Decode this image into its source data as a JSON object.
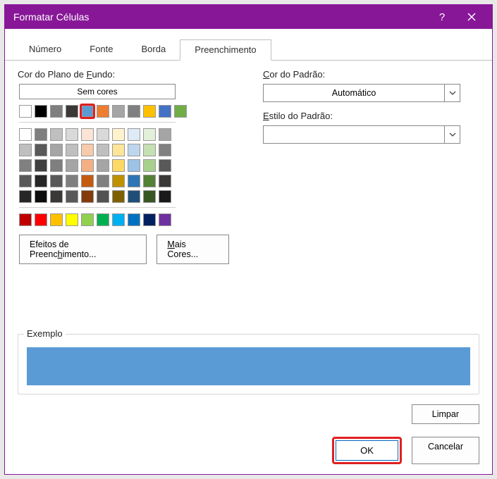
{
  "title": "Formatar Células",
  "tabs": {
    "numero": "Número",
    "fonte": "Fonte",
    "borda": "Borda",
    "preenchimento": "Preenchimento"
  },
  "left": {
    "bgLabelPre": "Cor do Plano de ",
    "bgLabelU": "F",
    "bgLabelPost": "undo:",
    "noColor": "Sem cores",
    "stdColors": [
      "#ffffff",
      "#000000",
      "#7f7f7f",
      "#3b3838",
      "#5b9bd5",
      "#ed7d31",
      "#a5a5a5",
      "#808080",
      "#ffc000",
      "#4472c4",
      "#70ad47"
    ],
    "themeGrid": [
      [
        "#ffffff",
        "#7f7f7f",
        "#bfbfbf",
        "#d9d9d9",
        "#fbe4d5",
        "#d9d9d9",
        "#fff2cc",
        "#deeaf6",
        "#e2efd9",
        "#a5a5a5"
      ],
      [
        "#bfbfbf",
        "#595959",
        "#a5a5a5",
        "#bfbfbf",
        "#f7caac",
        "#bfbfbf",
        "#ffe599",
        "#bdd6ee",
        "#c5e0b3",
        "#808080"
      ],
      [
        "#808080",
        "#404040",
        "#7f7f7f",
        "#a5a5a5",
        "#f4b083",
        "#a5a5a5",
        "#ffd966",
        "#9cc2e5",
        "#a8d08d",
        "#595959"
      ],
      [
        "#595959",
        "#262626",
        "#595959",
        "#7f7f7f",
        "#c55a11",
        "#808080",
        "#bf9000",
        "#2e75b5",
        "#538135",
        "#3b3838"
      ],
      [
        "#262626",
        "#0d0d0d",
        "#3b3838",
        "#595959",
        "#833c0b",
        "#525252",
        "#7f6000",
        "#1f4e79",
        "#375623",
        "#1a1a1a"
      ]
    ],
    "standard": [
      "#c00000",
      "#ff0000",
      "#ffc000",
      "#ffff00",
      "#92d050",
      "#00b050",
      "#00b0f0",
      "#0070c0",
      "#002060",
      "#7030a0"
    ],
    "fillEffectsPre": "Efeitos de Preenc",
    "fillEffectsU": "h",
    "fillEffectsPost": "imento...",
    "moreColorsU": "M",
    "moreColorsPost": "ais Cores..."
  },
  "right": {
    "patternColorU": "C",
    "patternColorPost": "or do Padrão:",
    "auto": "Automático",
    "patternStyleU": "E",
    "patternStylePost": "stilo do Padrão:",
    "patternStyleVal": ""
  },
  "example": "Exemplo",
  "buttons": {
    "limpar": "Limpar",
    "ok": "OK",
    "cancelar": "Cancelar"
  }
}
